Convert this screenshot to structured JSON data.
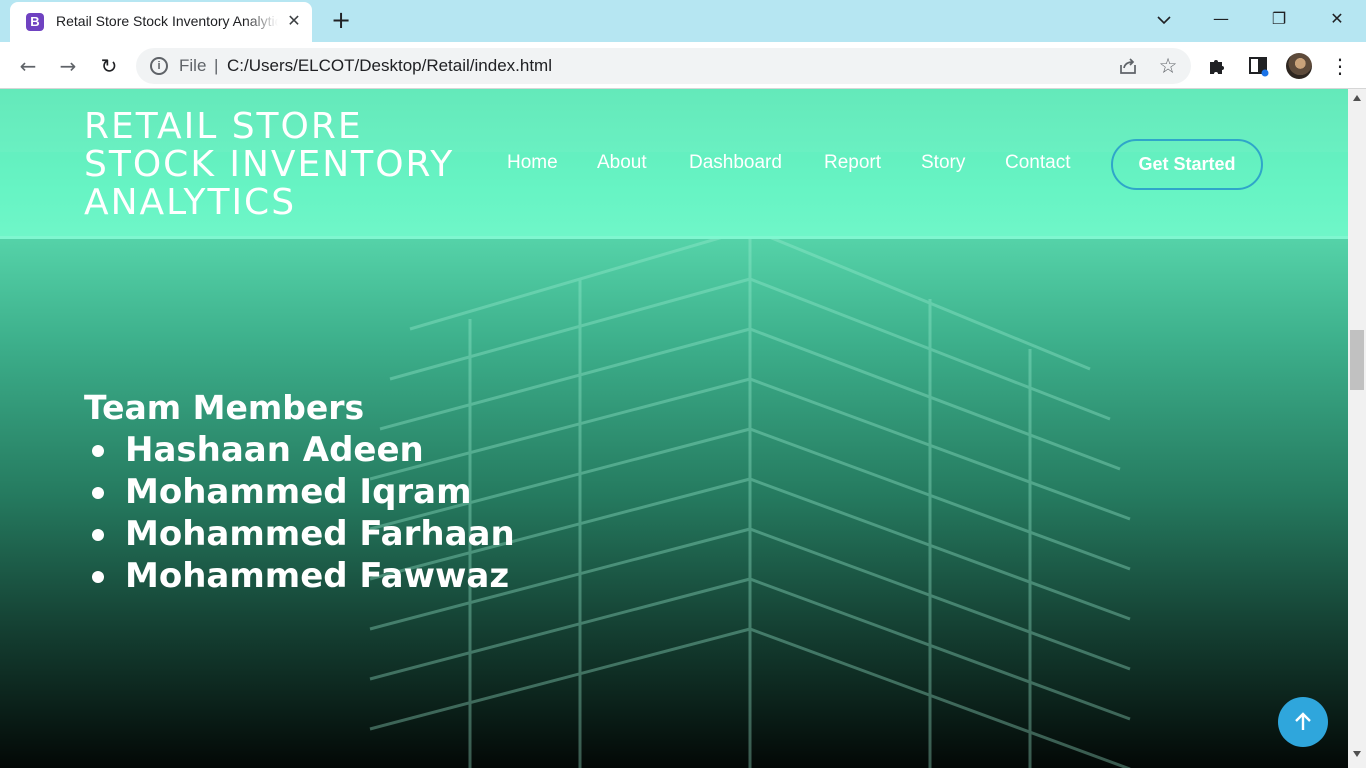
{
  "browser": {
    "tab": {
      "favicon_letter": "B",
      "title": "Retail Store Stock Inventory Analytics",
      "close_glyph": "✕"
    },
    "new_tab_glyph": "+",
    "window_controls": {
      "minimize": "—",
      "maximize": "❐",
      "close": "✕"
    },
    "toolbar": {
      "back_glyph": "←",
      "forward_glyph": "→",
      "reload_glyph": "↻",
      "scheme_label": "File",
      "separator": "|",
      "url": "C:/Users/ELCOT/Desktop/Retail/index.html",
      "bookmark_glyph": "☆",
      "menu_glyph": "⋮"
    }
  },
  "page": {
    "brand_lines": [
      "RETAIL STORE",
      "STOCK INVENTORY",
      "ANALYTICS"
    ],
    "nav": {
      "home": "Home",
      "about": "About",
      "dashboard": "Dashboard",
      "report": "Report",
      "story": "Story",
      "contact": "Contact"
    },
    "cta_label": "Get Started",
    "team": {
      "heading": "Team Members",
      "members": [
        "Hashaan Adeen",
        "Mohammed Iqram",
        "Mohammed Farhaan",
        "Mohammed Fawwaz"
      ]
    }
  },
  "colors": {
    "tabbar": "#b6e6f2",
    "header_mint": "#67f4c4",
    "cta_border": "#2fa6c9",
    "back_to_top": "#2fa6dc",
    "text": "#ffffff"
  },
  "icons": {
    "info": "info-icon",
    "share": "share-icon",
    "star": "star-icon",
    "extensions": "puzzle-icon",
    "side_panel": "side-panel-icon",
    "back_to_top": "arrow-up-icon"
  }
}
